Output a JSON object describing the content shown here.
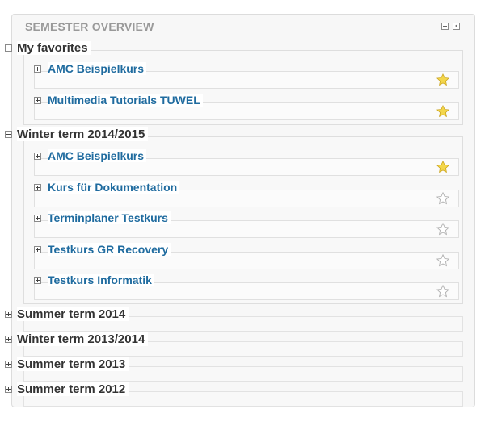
{
  "block": {
    "title": "SEMESTER OVERVIEW"
  },
  "groups": [
    {
      "label": "My favorites",
      "expanded": true,
      "courses": [
        {
          "name": "AMC Beispielkurs",
          "favorite": true
        },
        {
          "name": "Multimedia Tutorials TUWEL",
          "favorite": true
        }
      ]
    },
    {
      "label": "Winter term 2014/2015",
      "expanded": true,
      "courses": [
        {
          "name": "AMC Beispielkurs",
          "favorite": true
        },
        {
          "name": "Kurs für Dokumentation",
          "favorite": false
        },
        {
          "name": "Terminplaner Testkurs",
          "favorite": false
        },
        {
          "name": "Testkurs GR Recovery",
          "favorite": false
        },
        {
          "name": "Testkurs Informatik",
          "favorite": false
        }
      ]
    },
    {
      "label": "Summer term 2014",
      "expanded": false,
      "courses": []
    },
    {
      "label": "Winter term 2013/2014",
      "expanded": false,
      "courses": []
    },
    {
      "label": "Summer term 2013",
      "expanded": false,
      "courses": []
    },
    {
      "label": "Summer term 2012",
      "expanded": false,
      "courses": []
    }
  ],
  "colors": {
    "link": "#1f6b9f",
    "star_fill": "#f3d64b",
    "star_outline": "#b0b0b0"
  }
}
